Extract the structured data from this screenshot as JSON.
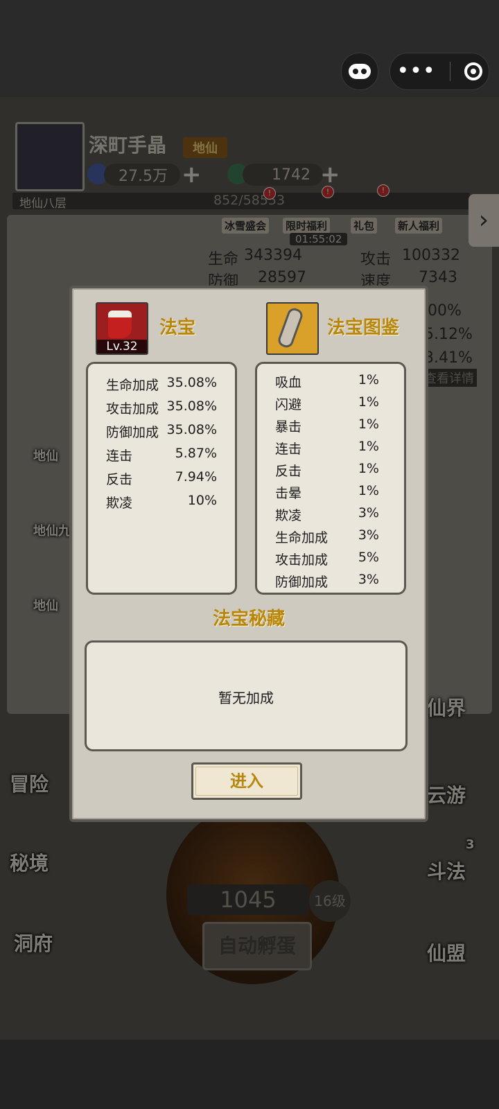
{
  "topbar": {
    "game_icon": "gamepad-icon",
    "more_icon": "more-dots-icon",
    "close_icon": "target-close-icon"
  },
  "player": {
    "name": "深町手晶",
    "rank_badge": "地仙",
    "spirit_stones": "27.5万",
    "jade": "1742",
    "realm": "地仙八层",
    "xp": "852/58553"
  },
  "events": [
    {
      "label": "冰雪盛会"
    },
    {
      "label": "限时福利",
      "timer": "01:55:02"
    },
    {
      "label": "礼包"
    },
    {
      "label": "新人福利"
    }
  ],
  "bg_stats": {
    "hp_label": "生命",
    "hp": "343394",
    "atk_label": "攻击",
    "atk": "100332",
    "def_label": "防御",
    "def": "28597",
    "spd_label": "速度",
    "spd": "7343",
    "p1": ".00%",
    "p2": "5.12%",
    "p3": "3.41%",
    "details": "查看详情"
  },
  "side_left": [
    "地仙",
    "地仙九",
    "地仙"
  ],
  "nav_left": [
    "冒险",
    "秘境",
    "洞府"
  ],
  "nav_right": [
    "仙界",
    "云游",
    "斗法",
    "仙盟"
  ],
  "duel_count": "3",
  "egg": {
    "counter": "1045",
    "grade": "16级",
    "auto_hatch": "自动孵蛋"
  },
  "modal": {
    "treasure_title": "法宝",
    "treasure_level": "Lv.32",
    "codex_title": "法宝图鉴",
    "treasure_stats": [
      {
        "name": "生命加成",
        "value": "35.08%"
      },
      {
        "name": "攻击加成",
        "value": "35.08%"
      },
      {
        "name": "防御加成",
        "value": "35.08%"
      },
      {
        "name": "连击",
        "value": "5.87%"
      },
      {
        "name": "反击",
        "value": "7.94%"
      },
      {
        "name": "欺凌",
        "value": "10%"
      }
    ],
    "codex_stats": [
      {
        "name": "吸血",
        "value": "1%"
      },
      {
        "name": "闪避",
        "value": "1%"
      },
      {
        "name": "暴击",
        "value": "1%"
      },
      {
        "name": "连击",
        "value": "1%"
      },
      {
        "name": "反击",
        "value": "1%"
      },
      {
        "name": "击晕",
        "value": "1%"
      },
      {
        "name": "欺凌",
        "value": "3%"
      },
      {
        "name": "生命加成",
        "value": "3%"
      },
      {
        "name": "攻击加成",
        "value": "5%"
      },
      {
        "name": "防御加成",
        "value": "3%"
      }
    ],
    "secret_title": "法宝秘藏",
    "secret_empty": "暂无加成",
    "enter_button": "进入"
  },
  "colors": {
    "gold_title": "#b7860f",
    "panel": "#cfcac0",
    "box": "#ebe6dc",
    "border": "#5b5852"
  }
}
